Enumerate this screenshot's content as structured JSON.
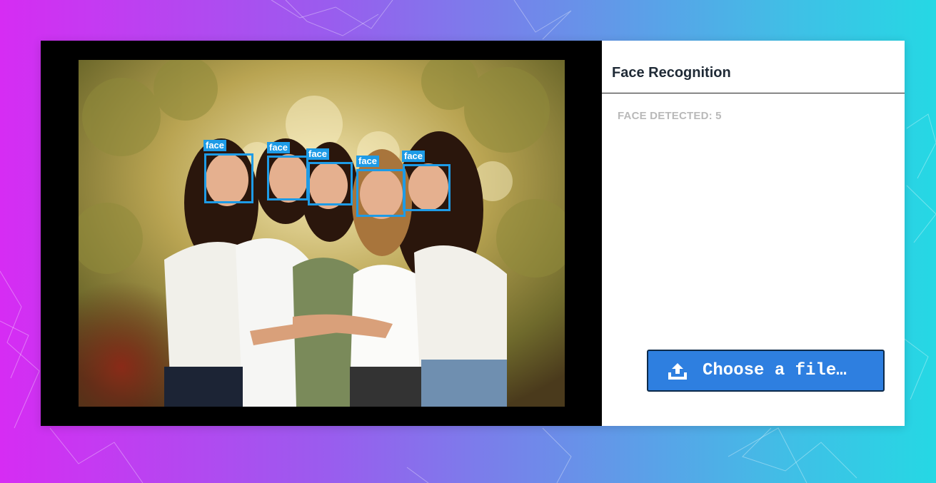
{
  "panel": {
    "title": "Face Recognition",
    "face_count_text": "FACE DETECTED: 5"
  },
  "upload": {
    "label": "Choose a file…",
    "icon": "upload-icon"
  },
  "detections": [
    {
      "label": "face"
    },
    {
      "label": "face"
    },
    {
      "label": "face"
    },
    {
      "label": "face"
    },
    {
      "label": "face"
    }
  ],
  "colors": {
    "accent": "#1e9be6",
    "button": "#2e7fe0",
    "title": "#1f2a36",
    "muted": "#b9b9b9"
  }
}
